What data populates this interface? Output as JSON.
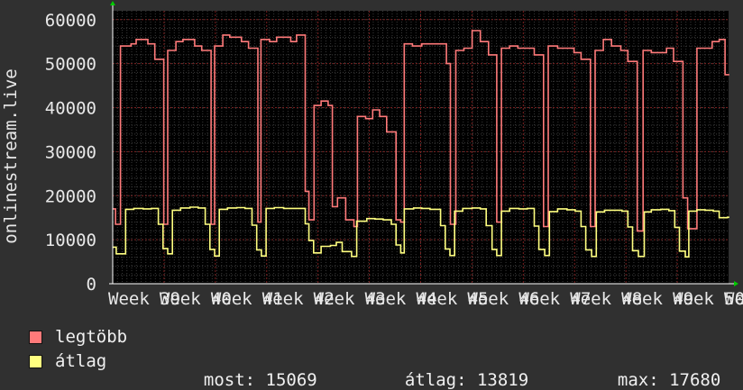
{
  "chart_data": {
    "type": "line",
    "ylabel": "onlinestream.live",
    "ylim": [
      0,
      62000
    ],
    "yticks": [
      0,
      10000,
      20000,
      30000,
      40000,
      50000,
      60000
    ],
    "xticks": [
      "Week 39",
      "Week 40",
      "Week 41",
      "Week 42",
      "Week 43",
      "Week 44",
      "Week 45",
      "Week 46",
      "Week 47",
      "Week 48",
      "Week 49",
      "Week 50",
      "Week 5"
    ],
    "grid": true,
    "series": [
      {
        "name": "legtöbb",
        "color": "#ff7a7a",
        "values": [
          17000,
          13500,
          54000,
          54500,
          55500,
          54500,
          51000,
          13500,
          53000,
          55000,
          55500,
          54000,
          53000,
          13500,
          54000,
          56500,
          56000,
          55000,
          53500,
          14000,
          55500,
          55000,
          56000,
          55000,
          56500,
          21000,
          14500,
          40500,
          41500,
          40500,
          17500,
          19500,
          14500,
          13000,
          38000,
          37500,
          39500,
          38000,
          34500,
          14500,
          14000,
          54500,
          54000,
          54500,
          54500,
          50000,
          13500,
          53000,
          53500,
          57500,
          55000,
          52000,
          14000,
          53500,
          54000,
          53500,
          53500,
          52000,
          13000,
          54000,
          53500,
          53500,
          52500,
          51000,
          13000,
          53000,
          55500,
          54000,
          53000,
          50500,
          12000,
          53000,
          52500,
          52500,
          53500,
          50500,
          19500,
          12500,
          53500,
          53500,
          55000,
          55500,
          47500,
          47500
        ],
        "x": [
          0,
          0.12,
          0.33,
          0.78,
          1.0,
          1.5,
          1.8,
          2.18,
          2.35,
          2.7,
          3.0,
          3.5,
          3.8,
          4.2,
          4.35,
          4.7,
          5.0,
          5.5,
          5.8,
          6.2,
          6.33,
          6.7,
          7.0,
          7.6,
          7.85,
          8.22,
          8.38,
          8.6,
          8.9,
          9.2,
          9.38,
          9.6,
          9.95,
          10.3,
          10.45,
          10.8,
          11.1,
          11.4,
          11.7,
          12.1,
          12.3,
          12.45,
          12.8,
          13.2,
          13.9,
          14.25,
          14.42,
          14.65,
          15.0,
          15.35,
          15.7,
          16.05,
          16.4,
          16.6,
          16.95,
          17.3,
          17.7,
          18.0,
          18.4,
          18.6,
          19.0,
          19.35,
          19.7,
          20.0,
          20.4,
          20.6,
          20.95,
          21.3,
          21.7,
          22.0,
          22.4,
          22.65,
          23.0,
          23.35,
          23.65,
          23.95,
          24.35,
          24.55,
          24.95,
          25.3,
          25.6,
          25.9,
          26.15,
          26.25
        ]
      },
      {
        "name": "átlag",
        "color": "#ffff80",
        "values": [
          8300,
          6800,
          16900,
          17100,
          17000,
          17100,
          13500,
          8000,
          6800,
          16700,
          17200,
          17400,
          17200,
          13500,
          7800,
          6300,
          16900,
          17200,
          17300,
          17100,
          13300,
          7700,
          6300,
          17100,
          17300,
          17100,
          17100,
          13600,
          9800,
          7000,
          8500,
          8700,
          9400,
          7300,
          6200,
          14200,
          14800,
          14700,
          14500,
          13500,
          8800,
          7000,
          17000,
          17200,
          17100,
          16900,
          13200,
          7900,
          6400,
          16500,
          17100,
          17200,
          17000,
          13200,
          7800,
          6400,
          16500,
          17100,
          17000,
          17100,
          13100,
          7800,
          6400,
          16400,
          17000,
          16800,
          16500,
          13000,
          7700,
          6200,
          16300,
          16700,
          16700,
          16500,
          12900,
          7500,
          6200,
          16300,
          16800,
          16900,
          16600,
          12800,
          7400,
          6100,
          16500,
          16800,
          16700,
          16500,
          15000,
          15100
        ],
        "x": [
          0,
          0.15,
          0.55,
          0.9,
          1.3,
          1.65,
          1.95,
          2.15,
          2.35,
          2.55,
          2.9,
          3.3,
          3.65,
          3.95,
          4.15,
          4.35,
          4.55,
          4.9,
          5.3,
          5.65,
          5.95,
          6.15,
          6.35,
          6.55,
          6.9,
          7.3,
          7.9,
          8.22,
          8.38,
          8.58,
          8.9,
          9.3,
          9.55,
          9.8,
          10.2,
          10.42,
          10.85,
          11.2,
          11.55,
          11.9,
          12.1,
          12.3,
          12.45,
          12.85,
          13.2,
          13.55,
          14.0,
          14.2,
          14.4,
          14.6,
          14.95,
          15.35,
          15.7,
          15.95,
          16.2,
          16.4,
          16.6,
          16.95,
          17.35,
          17.7,
          18.0,
          18.2,
          18.45,
          18.65,
          19.0,
          19.4,
          19.75,
          20.0,
          20.2,
          20.45,
          20.65,
          21.0,
          21.4,
          21.75,
          22.0,
          22.2,
          22.45,
          22.7,
          23.0,
          23.4,
          23.75,
          24.0,
          24.2,
          24.45,
          24.6,
          24.95,
          25.3,
          25.65,
          25.9,
          26.25
        ]
      }
    ]
  },
  "legend": {
    "items": [
      {
        "label": "legtöbb",
        "color": "#ff7a7a"
      },
      {
        "label": "átlag",
        "color": "#ffff80"
      }
    ],
    "stats": {
      "most_label": "most:",
      "most_value": "15069",
      "atlag_label": "átlag:",
      "atlag_value": "13819",
      "max_label": "max:",
      "max_value": "17680"
    }
  }
}
